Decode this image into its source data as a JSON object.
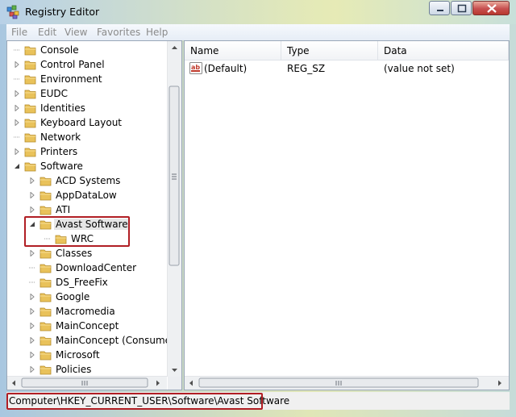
{
  "window": {
    "title": "Registry Editor"
  },
  "menu": [
    "File",
    "Edit",
    "View",
    "Favorites",
    "Help"
  ],
  "tree": [
    {
      "label": "Console",
      "expander": "none"
    },
    {
      "label": "Control Panel",
      "expander": "collapsed"
    },
    {
      "label": "Environment",
      "expander": "none"
    },
    {
      "label": "EUDC",
      "expander": "collapsed"
    },
    {
      "label": "Identities",
      "expander": "collapsed"
    },
    {
      "label": "Keyboard Layout",
      "expander": "collapsed"
    },
    {
      "label": "Network",
      "expander": "none"
    },
    {
      "label": "Printers",
      "expander": "collapsed"
    },
    {
      "label": "Software",
      "expander": "expanded"
    },
    {
      "label": "ACD Systems",
      "expander": "collapsed"
    },
    {
      "label": "AppDataLow",
      "expander": "collapsed"
    },
    {
      "label": "ATI",
      "expander": "collapsed"
    },
    {
      "label": "Avast Software",
      "expander": "expanded",
      "selected": true
    },
    {
      "label": "WRC",
      "expander": "none"
    },
    {
      "label": "Classes",
      "expander": "collapsed"
    },
    {
      "label": "DownloadCenter",
      "expander": "none"
    },
    {
      "label": "DS_FreeFix",
      "expander": "none"
    },
    {
      "label": "Google",
      "expander": "collapsed"
    },
    {
      "label": "Macromedia",
      "expander": "collapsed"
    },
    {
      "label": "MainConcept",
      "expander": "collapsed"
    },
    {
      "label": "MainConcept (Consumer)",
      "expander": "collapsed"
    },
    {
      "label": "Microsoft",
      "expander": "collapsed"
    },
    {
      "label": "Policies",
      "expander": "collapsed"
    }
  ],
  "list": {
    "columns": [
      "Name",
      "Type",
      "Data"
    ],
    "rows": [
      {
        "name": "(Default)",
        "type": "REG_SZ",
        "data": "(value not set)",
        "icon": "string-value-icon"
      }
    ]
  },
  "status": {
    "path": "Computer\\HKEY_CURRENT_USER\\Software\\Avast Software"
  },
  "colors": {
    "highlight_box": "#b11e24",
    "folder": "#e9c25a"
  }
}
